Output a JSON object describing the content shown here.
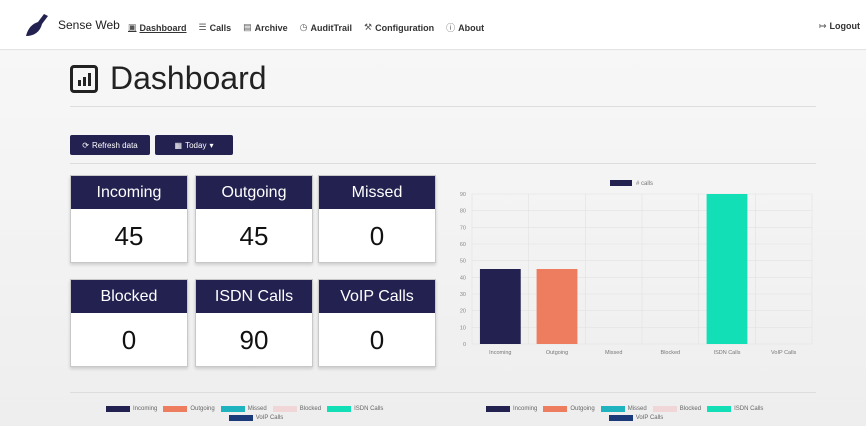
{
  "brand": {
    "name": "Sense Web"
  },
  "nav": [
    {
      "label": "Dashboard",
      "icon": "dashboard-icon",
      "glyph": "▣",
      "active": true
    },
    {
      "label": "Calls",
      "icon": "list-icon",
      "glyph": "☰",
      "active": false
    },
    {
      "label": "Archive",
      "icon": "archive-icon",
      "glyph": "▤",
      "active": false
    },
    {
      "label": "AuditTrail",
      "icon": "history-icon",
      "glyph": "◷",
      "active": false
    },
    {
      "label": "Configuration",
      "icon": "tools-icon",
      "glyph": "⚒",
      "active": false
    },
    {
      "label": "About",
      "icon": "info-icon",
      "glyph": "ⓘ",
      "active": false
    }
  ],
  "logout": {
    "label": "Logout",
    "icon": "logout-icon",
    "glyph": "↦"
  },
  "page": {
    "title": "Dashboard",
    "title_icon": "chart-icon"
  },
  "toolbar": {
    "refresh_label": "Refresh data",
    "refresh_icon": "refresh-icon",
    "refresh_glyph": "⟳",
    "period_label": "Today",
    "period_icon": "calendar-icon",
    "period_glyph": "▦",
    "caret": "▾"
  },
  "stats": [
    {
      "label": "Incoming",
      "value": "45"
    },
    {
      "label": "Outgoing",
      "value": "45"
    },
    {
      "label": "Missed",
      "value": "0"
    },
    {
      "label": "Blocked",
      "value": "0"
    },
    {
      "label": "ISDN Calls",
      "value": "90"
    },
    {
      "label": "VoIP Calls",
      "value": "0"
    }
  ],
  "colors": {
    "Incoming": "#232150",
    "Outgoing": "#ee7c5e",
    "Missed": "#1eb3bf",
    "Blocked": "#f0d6d6",
    "ISDN Calls": "#12dfb6",
    "VoIP Calls": "#1b3a7a"
  },
  "legend_items": [
    "Incoming",
    "Outgoing",
    "Missed",
    "Blocked",
    "ISDN Calls",
    "VoIP Calls"
  ],
  "chart_data": {
    "type": "bar",
    "categories": [
      "Incoming",
      "Outgoing",
      "Missed",
      "Blocked",
      "ISDN Calls",
      "VoIP Calls"
    ],
    "series": [
      {
        "name": "# calls",
        "values": [
          45,
          45,
          0,
          0,
          90,
          0
        ]
      }
    ],
    "ylim": [
      0,
      90
    ],
    "yticks": [
      0,
      10,
      20,
      30,
      40,
      50,
      60,
      70,
      80,
      90
    ],
    "grid": true,
    "legend": "top"
  }
}
